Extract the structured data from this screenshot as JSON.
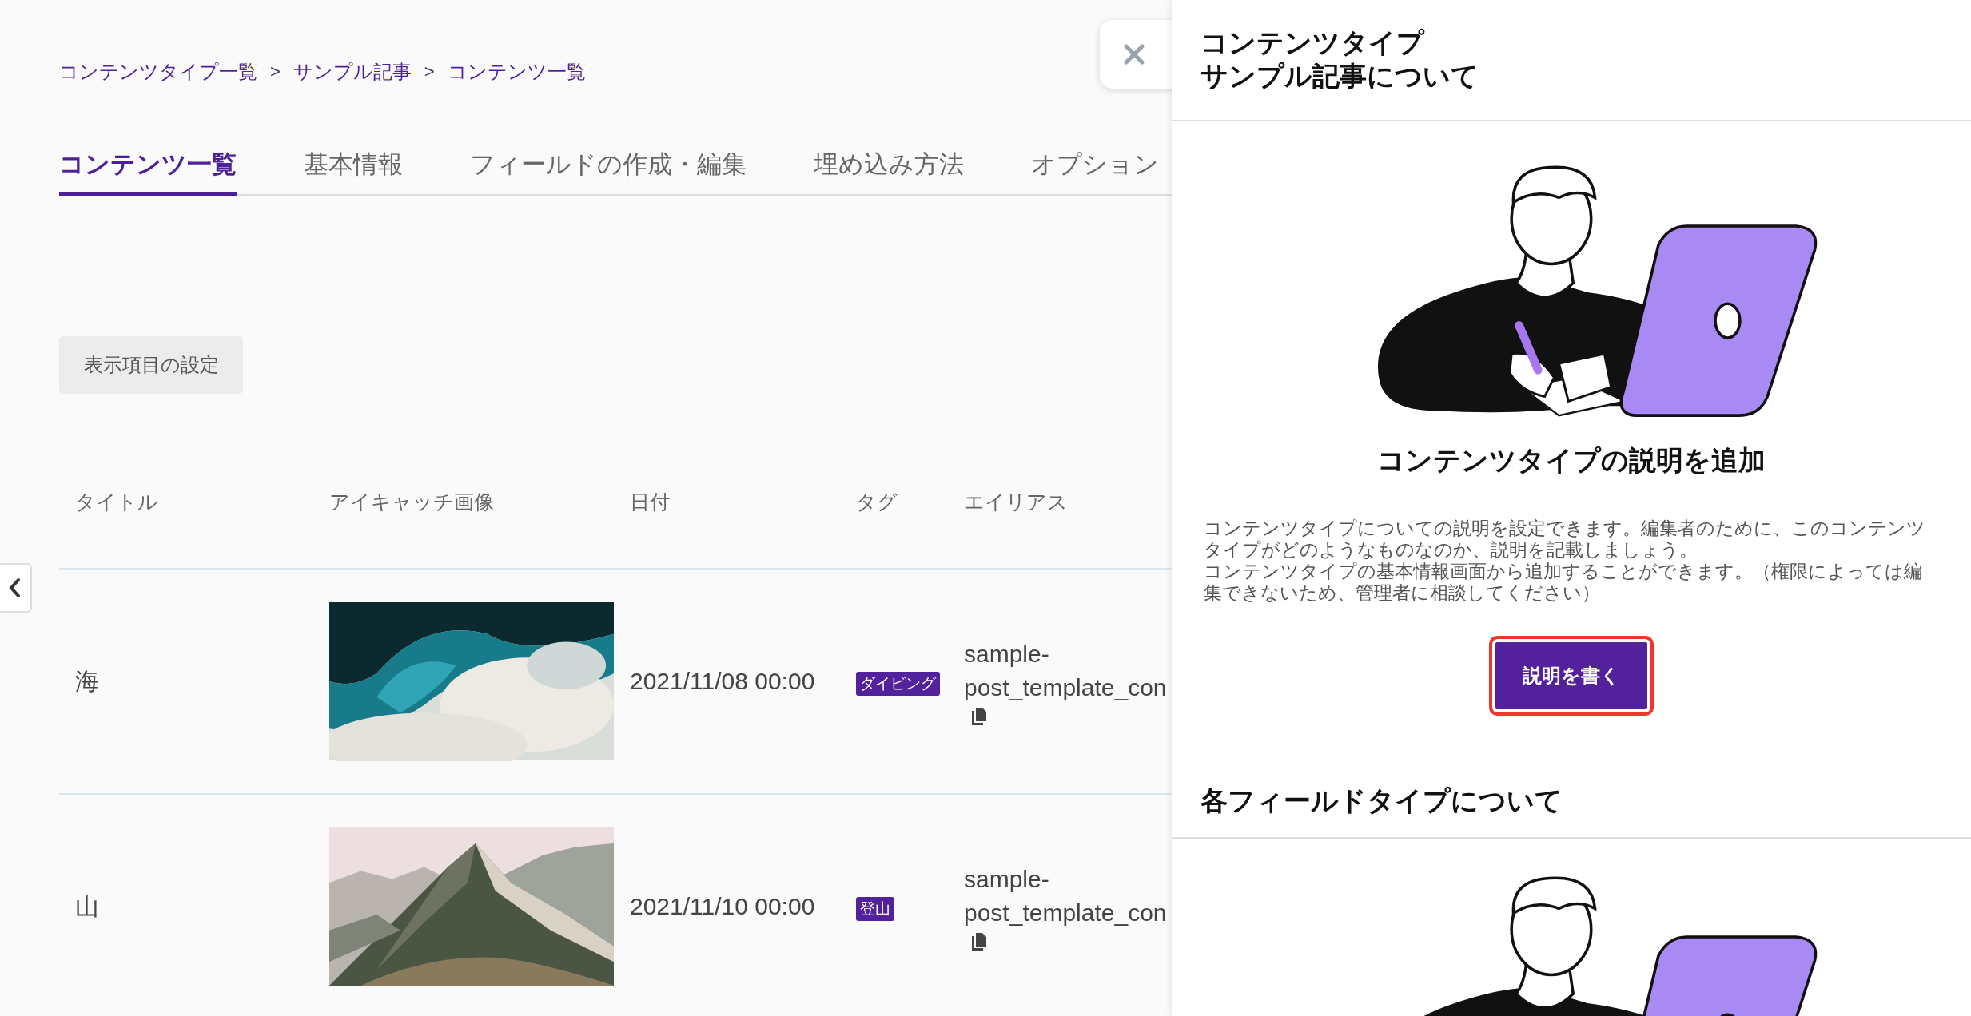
{
  "breadcrumb": [
    {
      "kind": "link",
      "text": "コンテンツタイプ一覧"
    },
    {
      "kind": "separator",
      "text": ">"
    },
    {
      "kind": "link",
      "text": "サンプル記事"
    },
    {
      "kind": "separator",
      "text": ">"
    },
    {
      "kind": "link",
      "text": "コンテンツ一覧"
    }
  ],
  "tabs": [
    {
      "label": "コンテンツ一覧",
      "selected": true
    },
    {
      "label": "基本情報",
      "selected": false
    },
    {
      "label": "フィールドの作成・編集",
      "selected": false
    },
    {
      "label": "埋め込み方法",
      "selected": false
    },
    {
      "label": "オプション",
      "selected": false
    }
  ],
  "display_settings_button": "表示項目の設定",
  "table": {
    "columns": [
      "タイトル",
      "アイキャッチ画像",
      "日付",
      "タグ",
      "エイリアス"
    ],
    "rows": [
      {
        "title": "海",
        "date": "2021/11/08 00:00",
        "tag": "ダイビング",
        "alias": "sample-post_template_con"
      },
      {
        "title": "山",
        "date": "2021/11/10 00:00",
        "tag": "登山",
        "alias": "sample-post_template_con"
      }
    ]
  },
  "panel": {
    "title_lines": [
      "コンテンツタイプ",
      "サンプル記事について"
    ],
    "heading": "コンテンツタイプの説明を追加",
    "description": [
      "コンテンツタイプについての説明を設定できます。編集者のために、このコンテンツタイプがどのようなものなのか、説明を記載しましょう。",
      "コンテンツタイプの基本情報画面から追加することができます。（権限によっては編集できないため、管理者に相談してください）"
    ],
    "write_button": {
      "label": "説明を書く",
      "focused": true
    },
    "section_heading": "各フィールドタイプについて"
  }
}
